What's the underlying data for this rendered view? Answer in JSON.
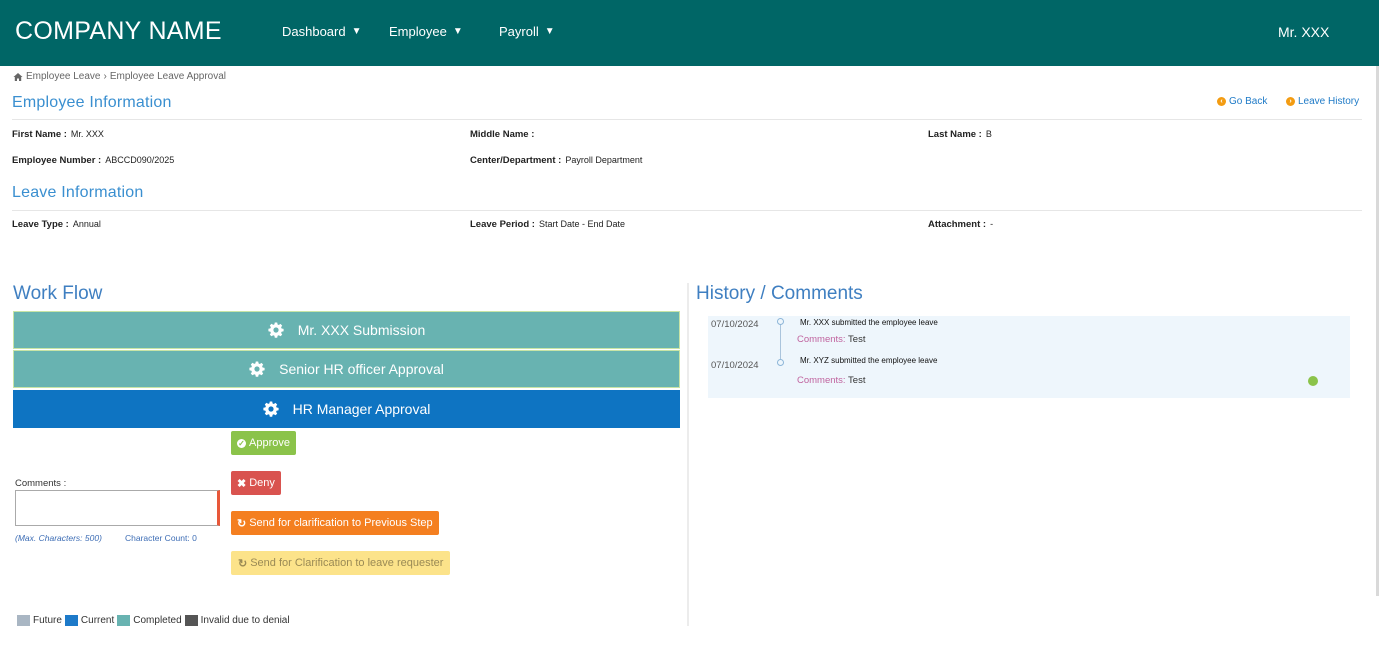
{
  "header": {
    "brand": "COMPANY NAME",
    "nav": [
      {
        "label": "Dashboard"
      },
      {
        "label": "Employee"
      },
      {
        "label": "Payroll"
      }
    ],
    "user": "Mr. XXX"
  },
  "breadcrumb": {
    "item1": "Employee Leave",
    "sep": "›",
    "item2": "Employee Leave Approval"
  },
  "employee_info": {
    "title": "Employee Information",
    "go_back": "Go Back",
    "leave_history": "Leave History",
    "first_name_label": "First Name :",
    "first_name": "Mr. XXX",
    "middle_name_label": "Middle Name :",
    "middle_name": "",
    "last_name_label": "Last Name :",
    "last_name": "B",
    "emp_no_label": "Employee Number :",
    "emp_no": "ABCCD090/2025",
    "center_label": "Center/Department :",
    "center": "Payroll Department"
  },
  "leave_info": {
    "title": "Leave Information",
    "type_label": "Leave Type :",
    "type": "Annual",
    "period_label": "Leave Period :",
    "period": "Start Date - End Date",
    "attachment_label": "Attachment :",
    "attachment": "-"
  },
  "workflow": {
    "title": "Work Flow",
    "steps": [
      {
        "label": "Mr. XXX Submission",
        "state": "completed"
      },
      {
        "label": "Senior HR officer Approval",
        "state": "completed"
      },
      {
        "label": "HR Manager Approval",
        "state": "current"
      }
    ],
    "buttons": {
      "approve": "Approve",
      "deny": "Deny",
      "clarify_previous": "Send for clarification to Previous Step",
      "clarify_requester": "Send for Clarification to leave requester"
    },
    "comments_label": "Comments :",
    "max_chars": "(Max. Characters: 500)",
    "char_count": "Character Count: 0",
    "legend": [
      {
        "label": "Future",
        "color": "#a9b6c3"
      },
      {
        "label": "Current",
        "color": "#1d7ac9"
      },
      {
        "label": "Completed",
        "color": "#68b3b1"
      },
      {
        "label": "Invalid due to denial",
        "color": "#555555"
      }
    ]
  },
  "history": {
    "title": "History / Comments",
    "entries": [
      {
        "date": "07/10/2024",
        "text": "Mr. XXX submitted the employee leave",
        "comment_key": "Comments:",
        "comment": "Test"
      },
      {
        "date": "07/10/2024",
        "text": "Mr. XYZ submitted the employee leave",
        "comment_key": "Comments:",
        "comment": "Test"
      }
    ]
  },
  "colors": {
    "topbar": "#006666",
    "completed": "#68b3b1",
    "current": "#0e74c2",
    "approve": "#8bc34a",
    "deny": "#d9534f",
    "clarify": "#f47f20",
    "clarify_requester": "#fce38a"
  }
}
